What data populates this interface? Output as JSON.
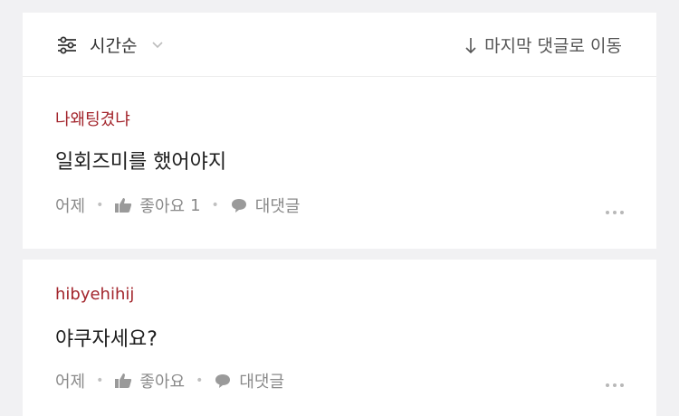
{
  "toolbar": {
    "sort_label": "시간순",
    "jump_label": "마지막 댓글로 이동"
  },
  "comments": [
    {
      "author": "나왜팅겼냐",
      "text": "일회즈미를 했어야지",
      "time": "어제",
      "like_label": "좋아요",
      "like_count": "1",
      "reply_label": "대댓글"
    },
    {
      "author": "hibyehihij",
      "text": "야쿠자세요?",
      "time": "어제",
      "like_label": "좋아요",
      "like_count": "",
      "reply_label": "대댓글"
    }
  ],
  "colors": {
    "author": "#a3252c",
    "meta": "#8a8a8a",
    "background": "#f1f1f3"
  },
  "icons": [
    "filter-sliders-icon",
    "chevron-down-icon",
    "arrow-down-icon",
    "thumbs-up-icon",
    "speech-bubble-icon",
    "more-dots-icon"
  ]
}
